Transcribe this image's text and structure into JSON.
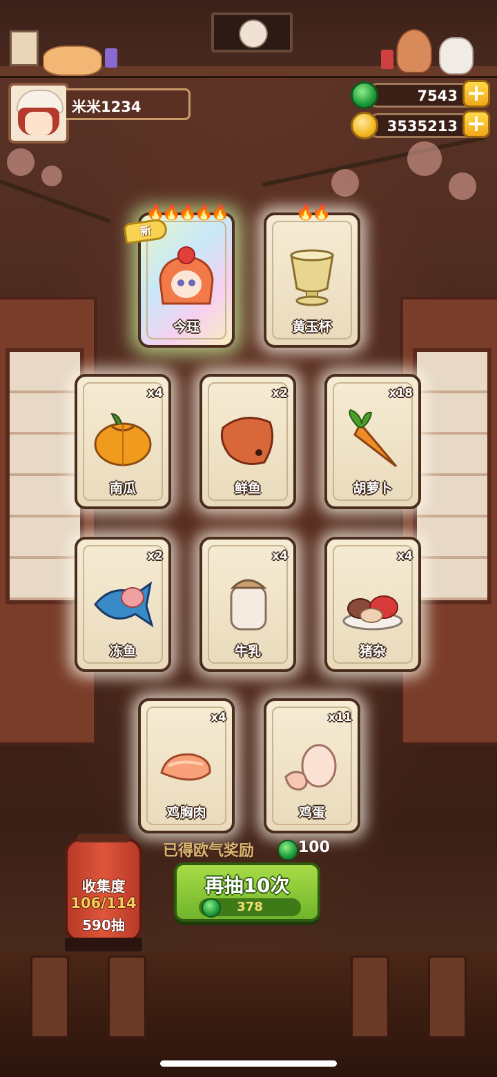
{
  "player": {
    "name": "米米1234"
  },
  "currency": {
    "jade": "7543",
    "coins": "3535213"
  },
  "cards": [
    {
      "label": "今珏",
      "count": "",
      "flames": "🔥🔥🔥🔥🔥",
      "badge": "新",
      "icon": "character-portrait-icon"
    },
    {
      "label": "黄玉杯",
      "count": "",
      "flames": "🔥🔥",
      "badge": "",
      "icon": "jade-cup-icon"
    },
    {
      "label": "南瓜",
      "count": "x4",
      "flames": "",
      "badge": "",
      "icon": "pumpkin-icon"
    },
    {
      "label": "鲜鱼",
      "count": "x2",
      "flames": "",
      "badge": "",
      "icon": "fresh-fish-icon"
    },
    {
      "label": "胡萝卜",
      "count": "x18",
      "flames": "",
      "badge": "",
      "icon": "carrot-icon"
    },
    {
      "label": "冻鱼",
      "count": "x2",
      "flames": "",
      "badge": "",
      "icon": "frozen-fish-icon"
    },
    {
      "label": "牛乳",
      "count": "x4",
      "flames": "",
      "badge": "",
      "icon": "milk-jar-icon"
    },
    {
      "label": "猪杂",
      "count": "x4",
      "flames": "",
      "badge": "",
      "icon": "pork-offal-icon"
    },
    {
      "label": "鸡胸肉",
      "count": "x4",
      "flames": "",
      "badge": "",
      "icon": "chicken-breast-icon"
    },
    {
      "label": "鸡蛋",
      "count": "x11",
      "flames": "",
      "badge": "",
      "icon": "egg-icon"
    }
  ],
  "reward": {
    "label": "已得欧气奖励",
    "value": "100"
  },
  "draw_button": {
    "label": "再抽10次",
    "cost": "378"
  },
  "collection": {
    "title": "收集度",
    "progress": "106/114",
    "draws": "590抽"
  },
  "colors": {
    "card_border": "#4a2d1f",
    "button_green": "#6fb42a",
    "lantern_red": "#e0553a",
    "jade": "#1f9a3a",
    "gold": "#f2b820"
  }
}
